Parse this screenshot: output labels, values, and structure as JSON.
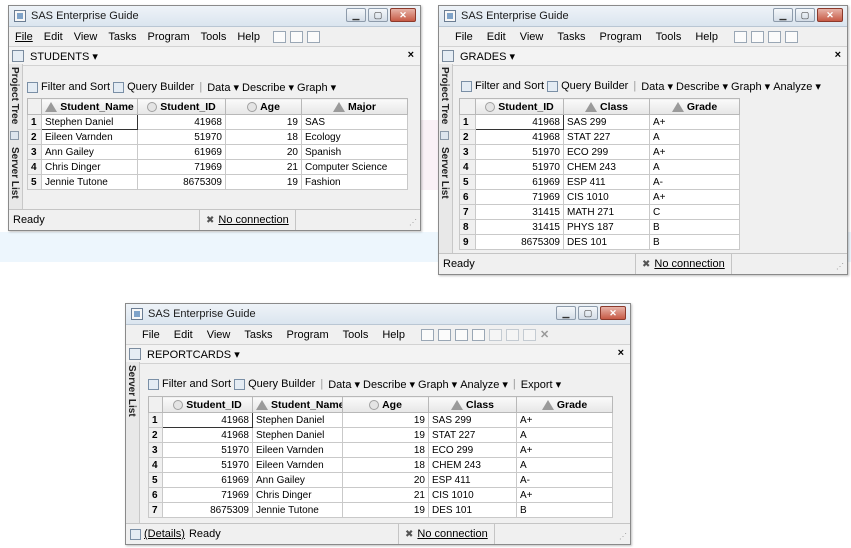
{
  "students_window": {
    "title": "SAS Enterprise Guide",
    "menu": [
      "File",
      "Edit",
      "View",
      "Tasks",
      "Program",
      "Tools",
      "Help"
    ],
    "doc_tab": "STUDENTS ▾",
    "side_tabs": [
      "Project Tree",
      "Server List"
    ],
    "toolbar": [
      "Filter and Sort",
      "Query Builder",
      "Data ▾",
      "Describe ▾",
      "Graph ▾"
    ],
    "columns": [
      "Student_Name",
      "Student_ID",
      "Age",
      "Major"
    ],
    "rows": [
      [
        "1",
        "Stephen Daniel",
        "41968",
        "19",
        "SAS"
      ],
      [
        "2",
        "Eileen Varnden",
        "51970",
        "18",
        "Ecology"
      ],
      [
        "3",
        "Ann Gailey",
        "61969",
        "20",
        "Spanish"
      ],
      [
        "4",
        "Chris Dinger",
        "71969",
        "21",
        "Computer Science"
      ],
      [
        "5",
        "Jennie Tutone",
        "8675309",
        "19",
        "Fashion"
      ]
    ],
    "status": "Ready",
    "connection": "No connection"
  },
  "grades_window": {
    "title": "SAS Enterprise Guide",
    "menu": [
      "File",
      "Edit",
      "View",
      "Tasks",
      "Program",
      "Tools",
      "Help"
    ],
    "doc_tab": "GRADES ▾",
    "side_tabs": [
      "Project Tree",
      "Server List"
    ],
    "toolbar": [
      "Filter and Sort",
      "Query Builder",
      "Data ▾",
      "Describe ▾",
      "Graph ▾",
      "Analyze ▾"
    ],
    "columns": [
      "Student_ID",
      "Class",
      "Grade"
    ],
    "rows": [
      [
        "1",
        "41968",
        "SAS 299",
        "A+"
      ],
      [
        "2",
        "41968",
        "STAT 227",
        "A"
      ],
      [
        "3",
        "51970",
        "ECO 299",
        "A+"
      ],
      [
        "4",
        "51970",
        "CHEM 243",
        "A"
      ],
      [
        "5",
        "61969",
        "ESP 411",
        "A-"
      ],
      [
        "6",
        "71969",
        "CIS 1010",
        "A+"
      ],
      [
        "7",
        "31415",
        "MATH 271",
        "C"
      ],
      [
        "8",
        "31415",
        "PHYS 187",
        "B"
      ],
      [
        "9",
        "8675309",
        "DES 101",
        "B"
      ]
    ],
    "status": "Ready",
    "connection": "No connection"
  },
  "reportcards_window": {
    "title": "SAS Enterprise Guide",
    "menu": [
      "File",
      "Edit",
      "View",
      "Tasks",
      "Program",
      "Tools",
      "Help"
    ],
    "doc_tab": "REPORTCARDS ▾",
    "side_tabs": [
      "Server List"
    ],
    "toolbar": [
      "Filter and Sort",
      "Query Builder",
      "Data ▾",
      "Describe ▾",
      "Graph ▾",
      "Analyze ▾",
      "Export ▾"
    ],
    "columns": [
      "Student_ID",
      "Student_Name",
      "Age",
      "Class",
      "Grade"
    ],
    "rows": [
      [
        "1",
        "41968",
        "Stephen Daniel",
        "19",
        "SAS 299",
        "A+"
      ],
      [
        "2",
        "41968",
        "Stephen Daniel",
        "19",
        "STAT 227",
        "A"
      ],
      [
        "3",
        "51970",
        "Eileen Varnden",
        "18",
        "ECO 299",
        "A+"
      ],
      [
        "4",
        "51970",
        "Eileen Varnden",
        "18",
        "CHEM 243",
        "A"
      ],
      [
        "5",
        "61969",
        "Ann Gailey",
        "20",
        "ESP 411",
        "A-"
      ],
      [
        "6",
        "71969",
        "Chris Dinger",
        "21",
        "CIS 1010",
        "A+"
      ],
      [
        "7",
        "8675309",
        "Jennie Tutone",
        "19",
        "DES 101",
        "B"
      ]
    ],
    "details": "(Details)",
    "status": "Ready",
    "connection": "No connection"
  }
}
